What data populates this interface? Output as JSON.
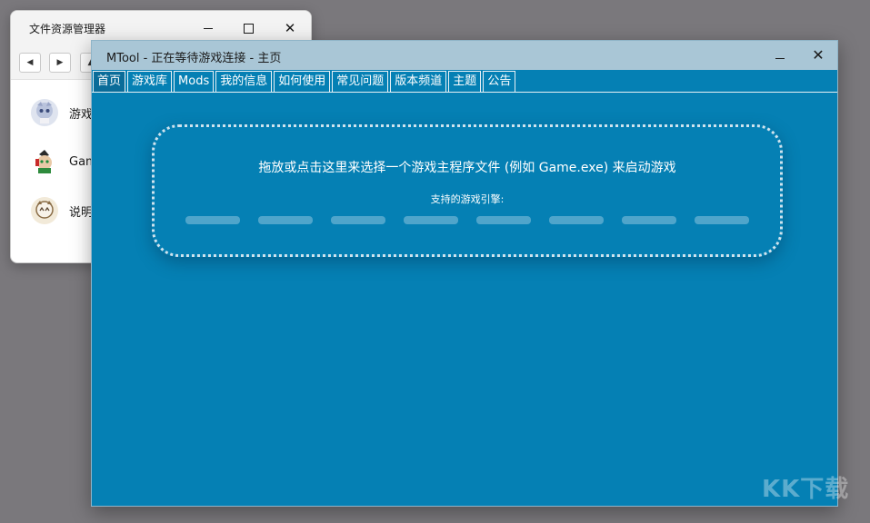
{
  "explorer": {
    "title": "文件资源管理器",
    "items": [
      {
        "label": "游戏",
        "icon": "anime-character-icon"
      },
      {
        "label": "Gam",
        "icon": "game-exe-icon"
      },
      {
        "label": "说明",
        "icon": "anime-character-icon"
      }
    ]
  },
  "mtool": {
    "title": "MTool - 正在等待游戏连接 - 主页",
    "tabs": [
      "首页",
      "游戏库",
      "Mods",
      "我的信息",
      "如何使用",
      "常见问题",
      "版本频道",
      "主题",
      "公告"
    ],
    "active_tab": "首页",
    "dropzone_text": "拖放或点击这里来选择一个游戏主程序文件 (例如 Game.exe) 来启动游戏",
    "engines_label": "支持的游戏引擎:",
    "engine_count": 8
  },
  "colors": {
    "mtool_bg": "#0580b4",
    "mtool_titlebar": "#a9c6d6",
    "desktop": "#7a787c"
  },
  "watermark": "KK下载"
}
